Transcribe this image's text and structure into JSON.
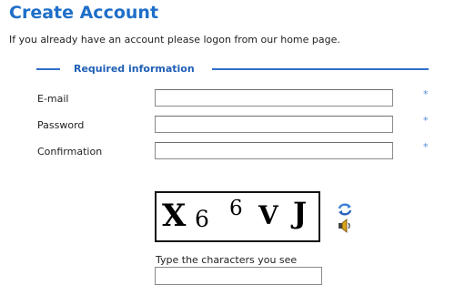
{
  "page": {
    "title": "Create Account",
    "intro": "If you already have an account please logon from our home page."
  },
  "form": {
    "legend": "Required information",
    "required_marker": "*",
    "fields": [
      {
        "label": "E-mail",
        "value": ""
      },
      {
        "label": "Password",
        "value": ""
      },
      {
        "label": "Confirmation",
        "value": ""
      }
    ]
  },
  "captcha": {
    "characters": [
      "X",
      "6",
      "6",
      "V",
      "J"
    ],
    "prompt": "Type the characters you see",
    "value": "",
    "refresh_icon": "refresh-icon",
    "audio_icon": "speaker-icon",
    "colors": {
      "refresh": "#3d7fd6",
      "audio": "#d8a21a"
    }
  }
}
